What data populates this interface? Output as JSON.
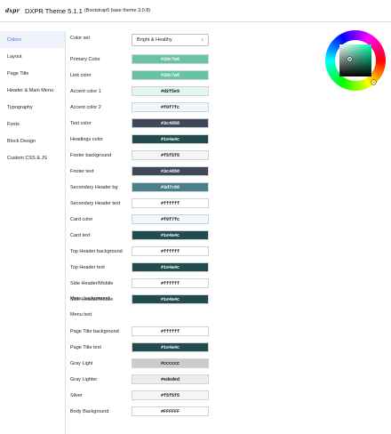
{
  "header": {
    "logo": "dxpr",
    "title": "DXPR Theme 5.1.1",
    "subtitle": "(Bootstrap5 base theme 3.0.8)"
  },
  "sidebar": {
    "items": [
      {
        "label": "Colors",
        "active": true
      },
      {
        "label": "Layout"
      },
      {
        "label": "Page Title"
      },
      {
        "label": "Header & Main Menu"
      },
      {
        "label": "Typography"
      },
      {
        "label": "Fonts"
      },
      {
        "label": "Block Design"
      },
      {
        "label": "Custom CSS & JS"
      }
    ]
  },
  "colorset": {
    "label": "Color set",
    "value": "Bright & Healthy"
  },
  "colors": [
    {
      "label": "Primary Color",
      "value": "#30c7a6",
      "bg": "#68c3a6",
      "fg": "#ffffff"
    },
    {
      "label": "Link color",
      "value": "#30c7a6",
      "bg": "#68c3a6",
      "fg": "#ffffff"
    },
    {
      "label": "Accent color 1",
      "value": "#d2f5e9",
      "bg": "#e2f5ee",
      "fg": "#111111"
    },
    {
      "label": "Accent color 2",
      "value": "#f0f7fc",
      "bg": "#f1f7fc",
      "fg": "#111111"
    },
    {
      "label": "Text color",
      "value": "#3c4858",
      "bg": "#3e4859",
      "fg": "#ffffff"
    },
    {
      "label": "Headings color",
      "value": "#1e4a4c",
      "bg": "#224b4d",
      "fg": "#ffffff"
    },
    {
      "label": "Footer background",
      "value": "#f5f5f5",
      "bg": "#f5f5f5",
      "fg": "#111111"
    },
    {
      "label": "Footer text",
      "value": "#3c4858",
      "bg": "#3e4859",
      "fg": "#ffffff"
    },
    {
      "label": "Secondary Header bg",
      "value": "#3d7c88",
      "bg": "#4a7e89",
      "fg": "#ffffff"
    },
    {
      "label": "Secondary Header text",
      "value": "#ffffff",
      "bg": "#ffffff",
      "fg": "#111111"
    },
    {
      "label": "Card color",
      "value": "#f0f7fc",
      "bg": "#f1f7fc",
      "fg": "#111111"
    },
    {
      "label": "Card text",
      "value": "#1e4a4c",
      "bg": "#224b4d",
      "fg": "#ffffff"
    },
    {
      "label": "Top Header background",
      "value": "#ffffff",
      "bg": "#ffffff",
      "fg": "#111111"
    },
    {
      "label": "Top Header text",
      "value": "#1e4a4c",
      "bg": "#224b4d",
      "fg": "#ffffff"
    },
    {
      "label": "Side Header/Mobile",
      "label2": "Menu background",
      "value": "#ffffff",
      "bg": "#ffffff",
      "fg": "#111111"
    },
    {
      "label": "Side Header/Mobile",
      "label2": "Menu text",
      "value": "#1e4a4c",
      "bg": "#224b4d",
      "fg": "#ffffff"
    },
    {
      "label": "Page Title background",
      "value": "#ffffff",
      "bg": "#ffffff",
      "fg": "#111111"
    },
    {
      "label": "Page Title text",
      "value": "#1e4a4c",
      "bg": "#224b4d",
      "fg": "#ffffff"
    },
    {
      "label": "Gray Light",
      "value": "#cccccc",
      "bg": "#cccccc",
      "fg": "#111111"
    },
    {
      "label": "Gray Lighter",
      "value": "#ededed",
      "bg": "#ededed",
      "fg": "#111111"
    },
    {
      "label": "Silver",
      "value": "#f5f5f5",
      "bg": "#f5f5f5",
      "fg": "#111111"
    },
    {
      "label": "Body Background",
      "value": "#FFFFFF",
      "bg": "#ffffff",
      "fg": "#111111"
    }
  ]
}
